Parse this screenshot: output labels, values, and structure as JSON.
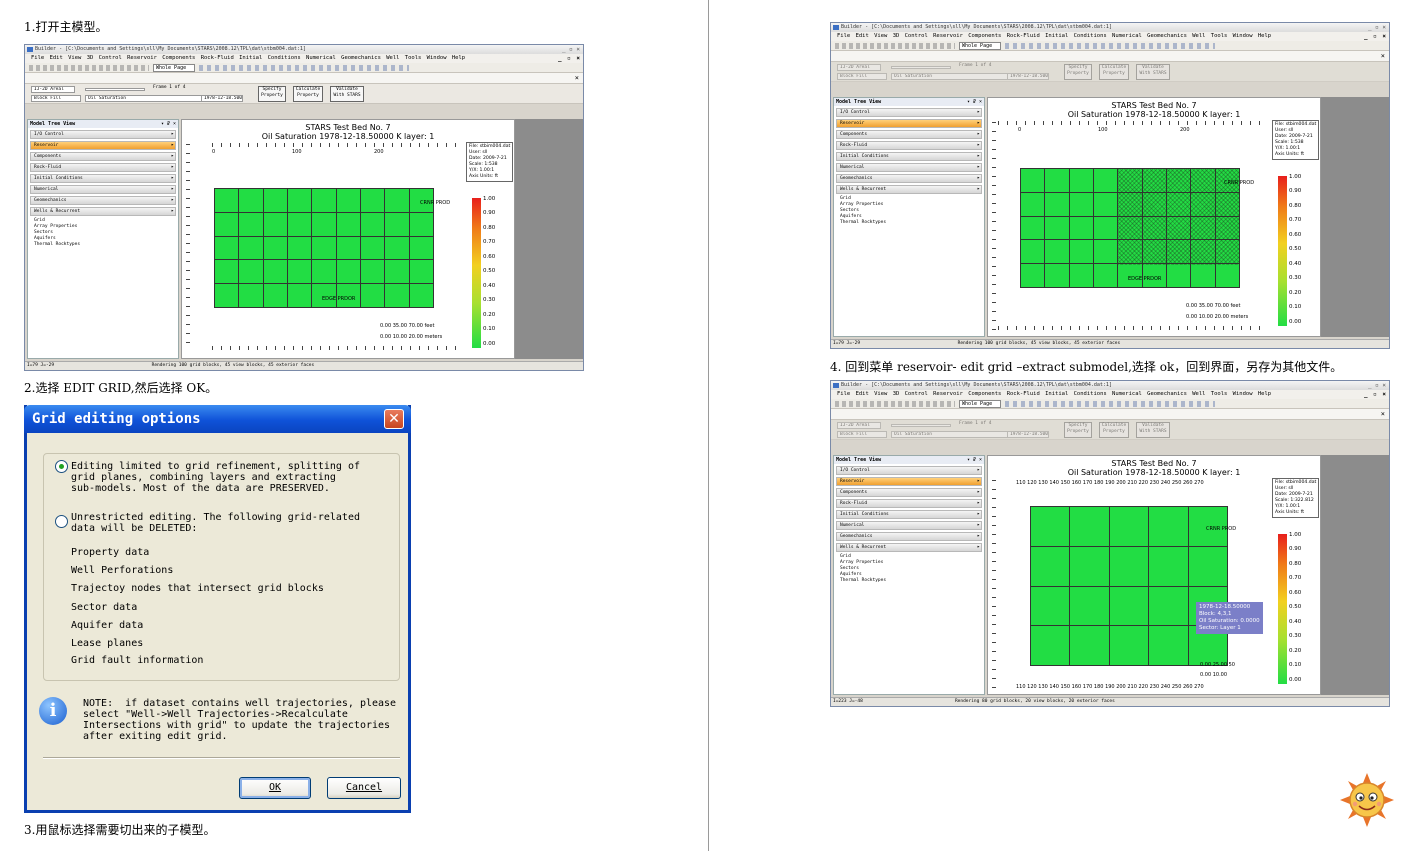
{
  "captions": {
    "step1": "1.打开主模型。",
    "step2": "2.选择 EDIT GRID,然后选择 OK。",
    "step3": "3.用鼠标选择需要切出来的子模型。",
    "step4": "4. 回到菜单 reservoir- edit grid –extract submodel,选择 ok，回到界面，另存为其他文件。"
  },
  "app": {
    "title": "Builder - [C:\\Documents and Settings\\sll\\My Documents\\STARS\\2008.12\\TPL\\dat\\stbm004.dat:1]",
    "menus": [
      "File",
      "Edit",
      "View",
      "3D Control",
      "Reservoir",
      "Components",
      "Rock-Fluid",
      "Initial Conditions",
      "Numerical",
      "Geomechanics",
      "Well",
      "Tools",
      "Window",
      "Help"
    ],
    "view_select": "Whole Page",
    "view_mode": "IJ-2D Areal",
    "frame_label": "Frame 1 of 4",
    "block_fill": "Block Fill",
    "property": "Oil Saturation",
    "date": "1978-12-18.5000",
    "btn_specify": "Specify Property",
    "btn_calculate": "Calculate Property",
    "btn_validate": "Validate With STARS",
    "tree_header": "Model Tree View",
    "tree_items": [
      "I/O Control",
      "Reservoir",
      "Components",
      "Rock-Fluid",
      "Initial Conditions",
      "Numerical",
      "Geomechanics",
      "Wells & Recurrent"
    ],
    "tree_sub": [
      "Grid",
      "Array Properties",
      "Sectors",
      "Aquifers",
      "Thermal Rocktypes"
    ],
    "plot_title1": "STARS Test Bed No. 7",
    "plot_title2": "Oil Saturation 1978-12-18.50000    K layer: 1",
    "info": [
      "File: stbim004.dat",
      "User: sll",
      "Date: 2009-7-21",
      "Scale: 1:538",
      "Y/X: 1.00:1",
      "Axis Units: ft"
    ],
    "info_small_scale": "Scale: 1:322.812",
    "well_prod": "CRNR PROD",
    "well_edge": "EDGE PRDOR",
    "legend": [
      "1.00",
      "0.90",
      "0.80",
      "0.70",
      "0.60",
      "0.50",
      "0.40",
      "0.30",
      "0.20",
      "0.10",
      "0.00"
    ],
    "scale_feet": "0.00    35.00    70.00 feet",
    "scale_m": "0.00    10.00    20.00 meters",
    "scale_feet_b": "0.00    25.00    50",
    "scale_m_b": "0.00    10.00",
    "x_ticks_a": [
      "0",
      "100",
      "200"
    ],
    "x_ticks_b": "110 120 130 140 150 160 170 180 190 200 210 220 230 240 250 260 270",
    "status1": "Rendering 100 grid blocks, 45 view blocks, 45 exterior faces",
    "status2": "Rendering 80 grid blocks, 20 view blocks, 20 exterior faces",
    "status_left1": "I=79 J=-29",
    "status_left2": "I=223 J=-48",
    "tooltip": [
      "1978-12-18.50000",
      "Block: 4,3,1",
      "Oil Saturation: 0.0000",
      "Sector: Layer 1"
    ]
  },
  "dialog": {
    "title": "Grid editing options",
    "opt1": "Editing limited to grid refinement, splitting of\ngrid planes, combining layers and extracting\nsub-models. Most of the data are PRESERVED.",
    "opt2": "Unrestricted editing. The following grid-related\ndata will be DELETED:",
    "items": [
      "Property data",
      "Well Perforations",
      "Trajectoy nodes that intersect grid blocks",
      "Sector data",
      "Aquifer data",
      "Lease planes",
      "Grid fault information"
    ],
    "note": "NOTE:  if dataset contains well trajectories, please\nselect \"Well->Well Trajectories->Recalculate\nIntersections with grid\" to update the trajectories\nafter exiting edit grid.",
    "ok": "OK",
    "cancel": "Cancel"
  },
  "colors": {
    "cell_green": "#22dd44",
    "tree_active": "#f0a030",
    "dialog_title": "#0f52d8"
  }
}
